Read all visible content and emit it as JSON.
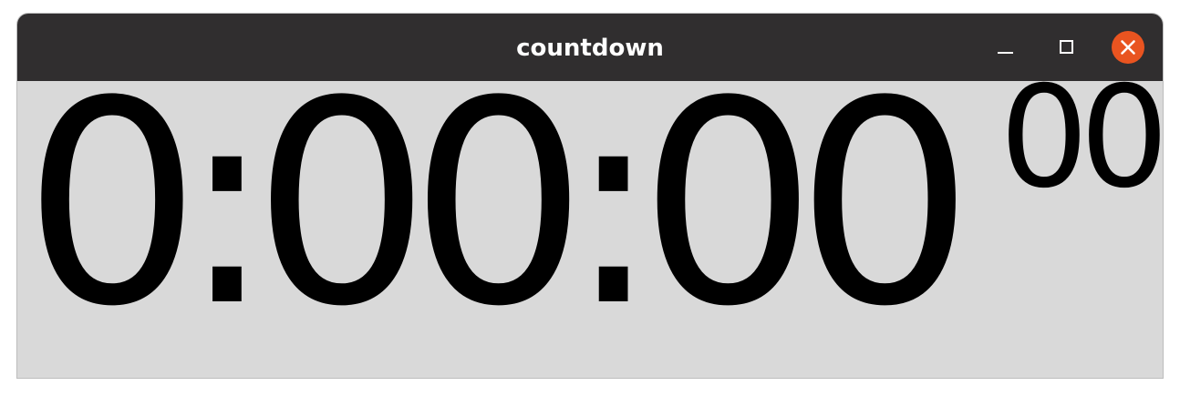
{
  "window": {
    "title": "countdown",
    "controls": {
      "minimize_icon": "minimize-icon",
      "maximize_icon": "maximize-icon",
      "close_icon": "close-icon",
      "close_color": "#e95420"
    }
  },
  "timer": {
    "display": "0:00:00",
    "hundredths": "00"
  },
  "colors": {
    "titlebar": "#302e2f",
    "background": "#d9d9d9",
    "text": "#000000"
  }
}
